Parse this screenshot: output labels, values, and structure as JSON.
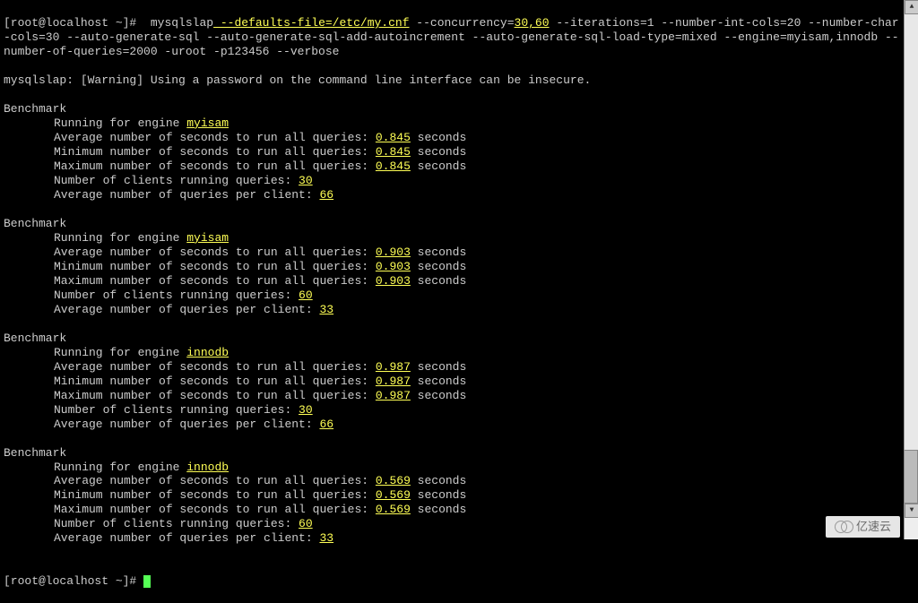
{
  "prompt": "[root@localhost ~]# ",
  "command": {
    "bin": "mysqlslap",
    "defaults_file": " --defaults-file=/etc/my.cnf",
    "concurrency_flag": " --concurrency=",
    "concurrency_val": "30,60",
    "rest": " --iterations=1 --number-int-cols=20 --number-char-cols=30 --auto-generate-sql --auto-generate-sql-add-autoincrement --auto-generate-sql-load-type=mixed --engine=myisam,innodb --number-of-queries=2000 -uroot -p123456 --verbose"
  },
  "warning": "mysqlslap: [Warning] Using a password on the command line interface can be insecure.",
  "labels": {
    "benchmark": "Benchmark",
    "running_for_engine": "Running for engine ",
    "avg_seconds": "Average number of seconds to run all queries: ",
    "min_seconds": "Minimum number of seconds to run all queries: ",
    "max_seconds": "Maximum number of seconds to run all queries: ",
    "num_clients": "Number of clients running queries: ",
    "avg_queries_per_client": "Average number of queries per client: ",
    "seconds": " seconds"
  },
  "benchmarks": [
    {
      "engine": "myisam",
      "avg": "0.845",
      "min": "0.845",
      "max": "0.845",
      "clients": "30",
      "per_client": "66"
    },
    {
      "engine": "myisam",
      "avg": "0.903",
      "min": "0.903",
      "max": "0.903",
      "clients": "60",
      "per_client": "33"
    },
    {
      "engine": "innodb",
      "avg": "0.987",
      "min": "0.987",
      "max": "0.987",
      "clients": "30",
      "per_client": "66"
    },
    {
      "engine": "innodb",
      "avg": "0.569",
      "min": "0.569",
      "max": "0.569",
      "clients": "60",
      "per_client": "33"
    }
  ],
  "watermark": "亿速云"
}
